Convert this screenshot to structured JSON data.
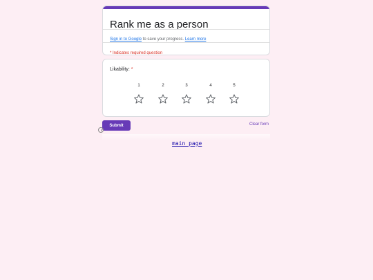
{
  "form": {
    "title": "Rank me as a person",
    "signin_link": "Sign in to Google",
    "signin_text": " to save your progress. ",
    "learn_more": "Learn more",
    "required_note": "* Indicates required question",
    "accent": "#673ab7"
  },
  "question": {
    "label": "Likability:",
    "required_mark": "*",
    "scale": [
      {
        "num": "1",
        "icon": "star-outline-icon",
        "selected": false
      },
      {
        "num": "2",
        "icon": "star-outline-icon",
        "selected": false
      },
      {
        "num": "3",
        "icon": "star-outline-icon",
        "selected": false
      },
      {
        "num": "4",
        "icon": "star-outline-icon",
        "selected": false
      },
      {
        "num": "5",
        "icon": "star-outline-icon",
        "selected": false
      }
    ]
  },
  "actions": {
    "submit_label": "Submit",
    "clear_label": "Clear form"
  },
  "page": {
    "main_page_link": "main page",
    "background": "#fdeef4"
  }
}
